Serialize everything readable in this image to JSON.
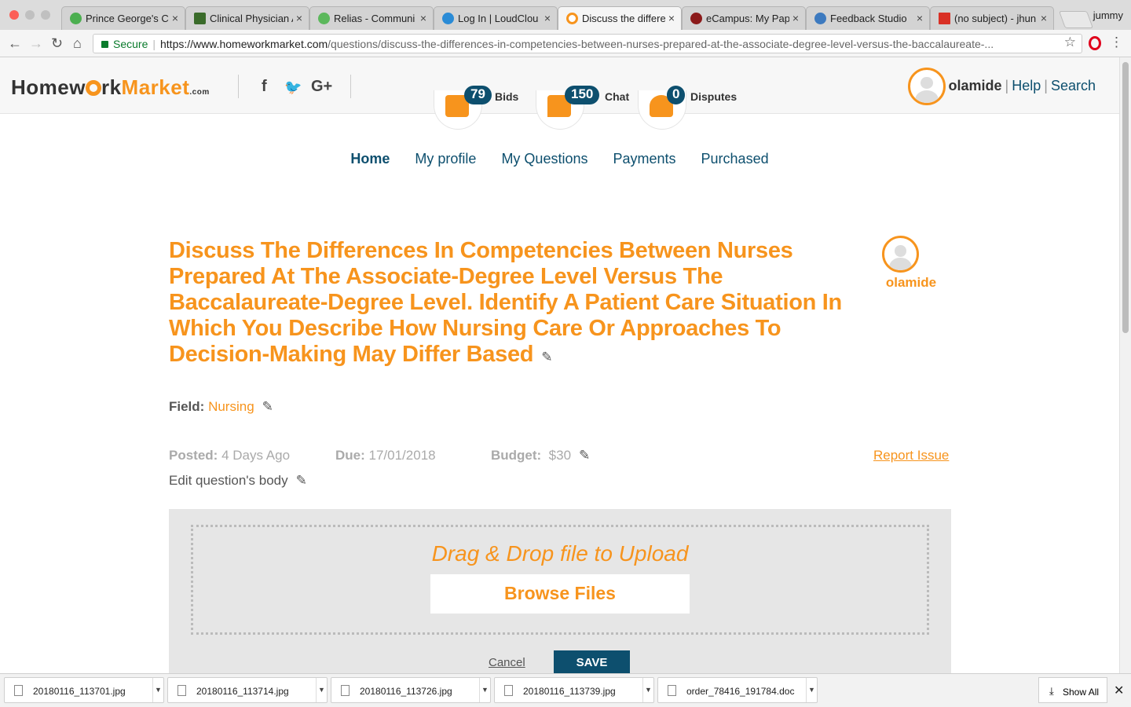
{
  "browser": {
    "tabs": [
      {
        "label": "Prince George's C",
        "favicon_color": "#4caf50"
      },
      {
        "label": "Clinical Physician A",
        "favicon_color": "#3a6b2a"
      },
      {
        "label": "Relias - Communi",
        "favicon_color": "#5cb85c"
      },
      {
        "label": "Log In | LoudClou",
        "favicon_color": "#2a8bd6"
      },
      {
        "label": "Discuss the differe",
        "favicon_color": "#f7941d"
      },
      {
        "label": "eCampus: My Pape",
        "favicon_color": "#8b1a1a"
      },
      {
        "label": "Feedback Studio",
        "favicon_color": "#3d7abf"
      },
      {
        "label": "(no subject) - jhun",
        "favicon_color": "#d93025"
      }
    ],
    "profile_name": "jummy",
    "secure_label": "Secure",
    "url_host": "https://www.homeworkmarket.com",
    "url_path": "/questions/discuss-the-differences-in-competencies-between-nurses-prepared-at-the-associate-degree-level-versus-the-baccalaureate-..."
  },
  "site": {
    "logo_a": "Homew",
    "logo_b": "rk",
    "logo_c": "Market",
    "logo_com": ".com",
    "social": {
      "facebook": "f",
      "twitter": "🐦",
      "google": "G+"
    },
    "header_items": [
      {
        "count": "79",
        "label": "Bids"
      },
      {
        "count": "150",
        "label": "Chat"
      },
      {
        "count": "0",
        "label": "Disputes"
      }
    ],
    "user": "olamide",
    "help": "Help",
    "search": "Search",
    "nav": [
      "Home",
      "My profile",
      "My Questions",
      "Payments",
      "Purchased"
    ]
  },
  "question": {
    "title": "Discuss The Differences In Competencies Between Nurses Prepared At The Associate-Degree Level Versus The Baccalaureate-Degree Level. Identify A Patient Care Situation In Which You Describe How Nursing Care Or Approaches To Decision-Making May Differ Based",
    "author": "olamide",
    "field_label": "Field:",
    "field_value": "Nursing",
    "posted_label": "Posted:",
    "posted_value": "4 Days Ago",
    "due_label": "Due:",
    "due_value": "17/01/2018",
    "budget_label": "Budget:",
    "budget_value": "$30",
    "report_issue": "Report Issue",
    "edit_body": "Edit question's body",
    "drop_text": "Drag & Drop file to Upload",
    "browse_files": "Browse Files",
    "cancel": "Cancel",
    "save": "SAVE"
  },
  "downloads": {
    "files": [
      "20180116_113701.jpg",
      "20180116_113714.jpg",
      "20180116_113726.jpg",
      "20180116_113739.jpg",
      "order_78416_191784.doc"
    ],
    "show_all": "Show All"
  },
  "colors": {
    "accent": "#f7941d",
    "brand_dark": "#0d4f6e"
  }
}
